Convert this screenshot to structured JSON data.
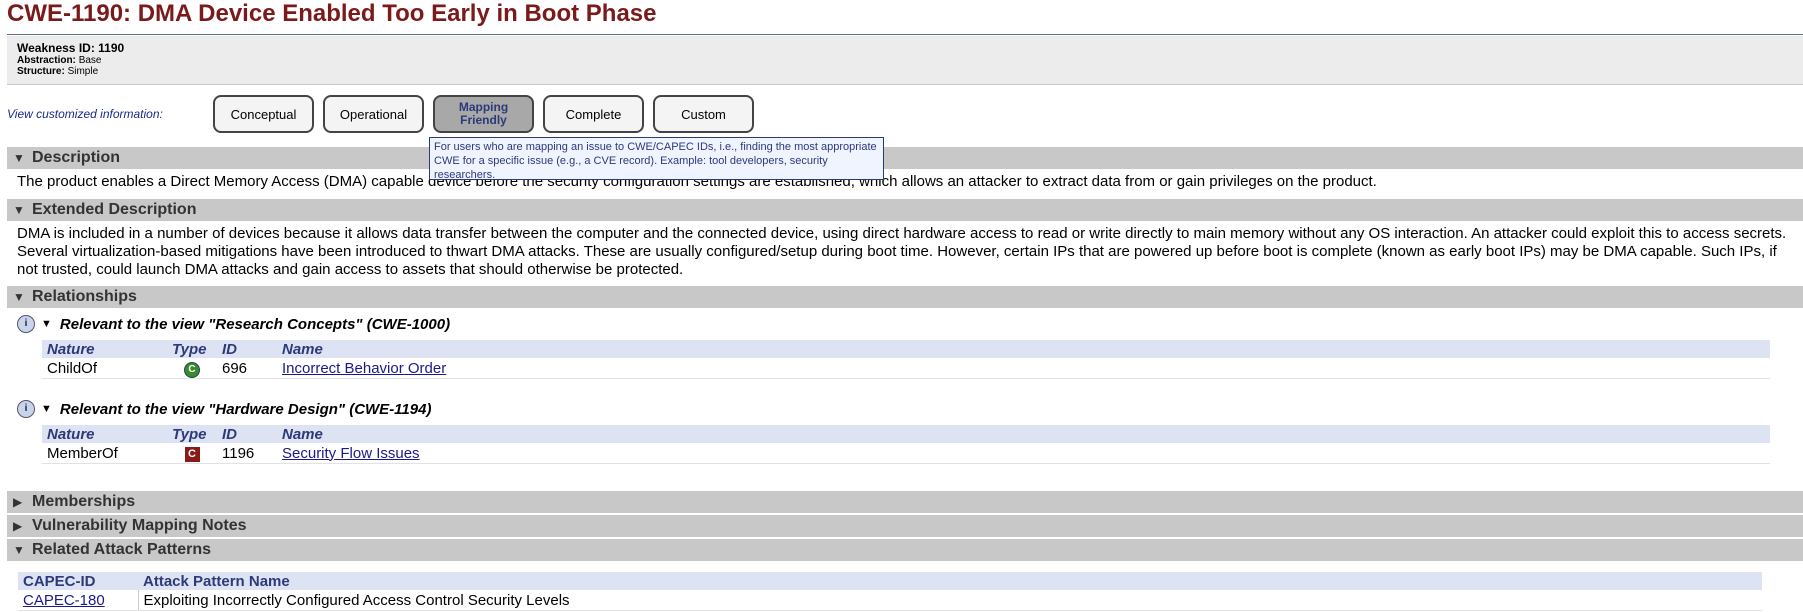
{
  "page": {
    "title": "CWE-1190: DMA Device Enabled Too Early in Boot Phase"
  },
  "meta": {
    "weakness_id": "Weakness ID: 1190",
    "abstraction_label": "Abstraction:",
    "abstraction_value": "Base",
    "structure_label": "Structure:",
    "structure_value": "Simple"
  },
  "views": {
    "label": "View customized information:",
    "buttons": [
      "Conceptual",
      "Operational",
      "Mapping Friendly",
      "Complete",
      "Custom"
    ],
    "active": "Mapping Friendly",
    "tooltip": "For users who are mapping an issue to CWE/CAPEC IDs, i.e., finding the most appropriate CWE for a specific issue (e.g., a CVE record). Example: tool developers, security researchers."
  },
  "sections": {
    "description": {
      "title": "Description",
      "text": "The product enables a Direct Memory Access (DMA) capable device before the security configuration settings are established, which allows an attacker to extract data from or gain privileges on the product."
    },
    "extended": {
      "title": "Extended Description",
      "text": "DMA is included in a number of devices because it allows data transfer between the computer and the connected device, using direct hardware access to read or write directly to main memory without any OS interaction. An attacker could exploit this to access secrets. Several virtualization-based mitigations have been introduced to thwart DMA attacks. These are usually configured/setup during boot time. However, certain IPs that are powered up before boot is complete (known as early boot IPs) may be DMA capable. Such IPs, if not trusted, could launch DMA attacks and gain access to assets that should otherwise be protected."
    },
    "relationships": {
      "title": "Relationships",
      "columns": [
        "Nature",
        "Type",
        "ID",
        "Name"
      ],
      "views": [
        {
          "heading": "Relevant to the view \"Research Concepts\" (CWE-1000)",
          "rows": [
            {
              "nature": "ChildOf",
              "type": "C",
              "id": "696",
              "name": "Incorrect Behavior Order"
            }
          ]
        },
        {
          "heading": "Relevant to the view \"Hardware Design\" (CWE-1194)",
          "rows": [
            {
              "nature": "MemberOf",
              "type": "C",
              "id": "1196",
              "name": "Security Flow Issues"
            }
          ]
        }
      ]
    },
    "memberships": {
      "title": "Memberships"
    },
    "vuln_mapping": {
      "title": "Vulnerability Mapping Notes"
    },
    "attack_patterns": {
      "title": "Related Attack Patterns",
      "columns": [
        "CAPEC-ID",
        "Attack Pattern Name"
      ],
      "rows": [
        {
          "id": "CAPEC-180",
          "name": "Exploiting Incorrectly Configured Access Control Security Levels"
        }
      ]
    }
  }
}
